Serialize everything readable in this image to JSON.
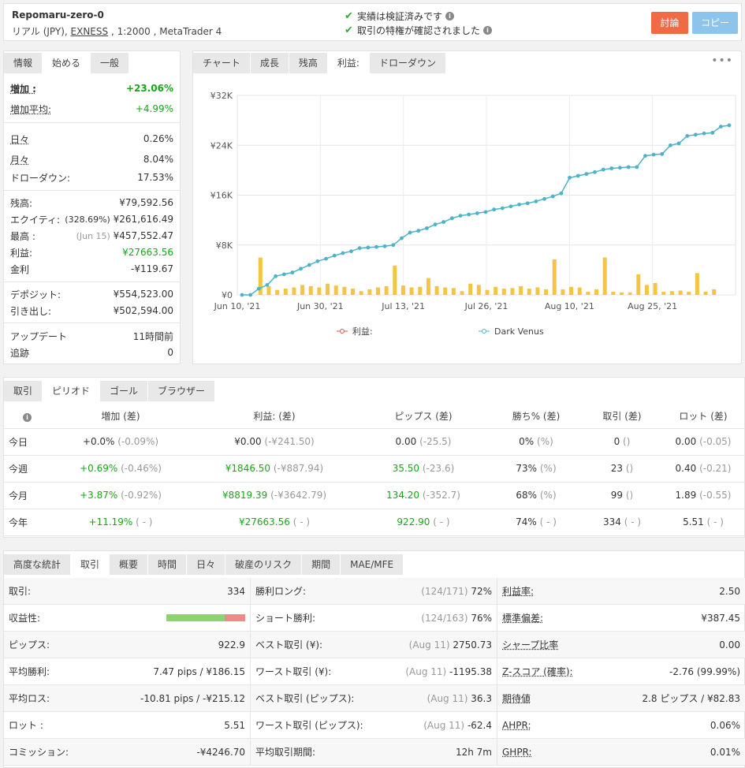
{
  "account": {
    "name": "Repomaru-zero-0",
    "info_prefix": "リアル (JPY), ",
    "broker": "EXNESS",
    "info_suffix": " , 1:2000 , MetaTrader 4",
    "verified_track": "実績は検証済みです",
    "verified_privileges": "取引の特権が確認されました",
    "discuss_label": "討論",
    "copy_label": "コピー"
  },
  "left_tabs": [
    "情報",
    "始める",
    "一般"
  ],
  "stats": {
    "gain": {
      "label": "増加 :",
      "value": "+23.06%"
    },
    "abs_gain": {
      "label": "増加平均:",
      "value": "+4.99%"
    },
    "daily": {
      "label": "日々",
      "value": "0.26%"
    },
    "monthly": {
      "label": "月々",
      "value": "8.04%"
    },
    "drawdown": {
      "label": "ドローダウン:",
      "value": "17.53%"
    },
    "balance": {
      "label": "残高:",
      "value": "¥79,592.56"
    },
    "equity": {
      "label": "エクイティ:",
      "note": "(328.69%)",
      "value": "¥261,616.49"
    },
    "highest": {
      "label": "最高 :",
      "note": "(Jun 15)",
      "value": "¥457,552.47"
    },
    "profit": {
      "label": "利益:",
      "value": "¥27663.56"
    },
    "interest": {
      "label": "金利",
      "value": "-¥119.67"
    },
    "deposits": {
      "label": "デポジット:",
      "value": "¥554,523.00"
    },
    "withdrawals": {
      "label": "引き出し:",
      "value": "¥502,594.00"
    },
    "updated": {
      "label": "アップデート",
      "value": "11時間前"
    },
    "tracking": {
      "label": "追跡",
      "value": "0"
    }
  },
  "chart_tabs": [
    "チャート",
    "成長",
    "残高",
    "利益:",
    "ドローダウン"
  ],
  "chart_more_icon": "more-dots-icon",
  "chart_data": {
    "type": "line",
    "y_ticks": [
      "¥0",
      "¥8K",
      "¥16K",
      "¥24K",
      "¥32K"
    ],
    "ylim": [
      0,
      32000
    ],
    "x_ticks": [
      "Jun 10, '21",
      "Jun 30, '21",
      "Jul 13, '21",
      "Jul 26, '21",
      "Aug 10, '21",
      "Aug 25, '21"
    ],
    "grid": true,
    "legend_position": "bottom",
    "series": [
      {
        "name": "利益:",
        "color": "#f4c542",
        "type": "bar",
        "values": [
          0,
          0,
          6000,
          1400,
          800,
          1000,
          1200,
          1600,
          1400,
          1200,
          1800,
          1500,
          1300,
          1000,
          600,
          900,
          1200,
          1400,
          4700,
          1500,
          1200,
          1300,
          2700,
          1400,
          1200,
          1100,
          600,
          1800,
          1600,
          800,
          1300,
          1000,
          1100,
          1400,
          1000,
          1200,
          900,
          5700,
          900,
          1300,
          1200,
          500,
          900,
          6000,
          500,
          400,
          400,
          3300,
          1600,
          1900,
          500,
          600,
          700,
          500,
          3500,
          500,
          900
        ]
      },
      {
        "name": "Dark Venus",
        "color": "#4cb3c8",
        "type": "line",
        "values": [
          0,
          0,
          1000,
          1600,
          3000,
          3300,
          3600,
          4200,
          4800,
          5400,
          5800,
          6300,
          6700,
          7000,
          7500,
          7600,
          7700,
          7800,
          8000,
          9100,
          10000,
          10300,
          10700,
          11300,
          11700,
          12300,
          12700,
          12900,
          13100,
          13300,
          13700,
          13900,
          14200,
          14500,
          14700,
          15000,
          15400,
          15800,
          16300,
          18800,
          19100,
          19400,
          19700,
          20100,
          20300,
          20400,
          20500,
          20500,
          22300,
          22500,
          22600,
          24000,
          24300,
          25500,
          25700,
          25900,
          26000,
          27000,
          27200
        ]
      }
    ]
  },
  "period": {
    "tabs": [
      "取引",
      "ピリオド",
      "ゴール",
      "ブラウザー"
    ],
    "headers": [
      "増加 (差)",
      "利益: (差)",
      "ピップス (差)",
      "勝ち% (差)",
      "取引 (差)",
      "ロット (差)"
    ],
    "rows": [
      {
        "name": "今日",
        "gain": "+0.0%",
        "gain_d": "(-0.09%)",
        "profit": "¥0.00",
        "profit_d": "(-¥241.50)",
        "pips": "0.00",
        "pips_d": "(-25.5)",
        "win": "0%",
        "win_d": "(%)",
        "trades": "0",
        "trades_d": "()",
        "lots": "0.00",
        "lots_d": "(-0.05)",
        "green": false
      },
      {
        "name": "今週",
        "gain": "+0.69%",
        "gain_d": "(-0.46%)",
        "profit": "¥1846.50",
        "profit_d": "(-¥887.94)",
        "pips": "35.50",
        "pips_d": "(-23.6)",
        "win": "73%",
        "win_d": "(%)",
        "trades": "23",
        "trades_d": "()",
        "lots": "0.40",
        "lots_d": "(-0.21)",
        "green": true
      },
      {
        "name": "今月",
        "gain": "+3.87%",
        "gain_d": "(-0.92%)",
        "profit": "¥8819.39",
        "profit_d": "(-¥3642.79)",
        "pips": "134.20",
        "pips_d": "(-352.7)",
        "win": "68%",
        "win_d": "(%)",
        "trades": "99",
        "trades_d": "()",
        "lots": "1.89",
        "lots_d": "(-0.55)",
        "green": true
      },
      {
        "name": "今年",
        "gain": "+11.19%",
        "gain_d": "( - )",
        "profit": "¥27663.56",
        "profit_d": "( - )",
        "pips": "922.90",
        "pips_d": "( - )",
        "win": "74%",
        "win_d": "( - )",
        "trades": "334",
        "trades_d": "( - )",
        "lots": "5.51",
        "lots_d": "( - )",
        "green": true
      }
    ]
  },
  "advanced": {
    "tabs": [
      "高度な統計",
      "取引",
      "概要",
      "時間",
      "日々",
      "破産のリスク",
      "期間",
      "MAE/MFE"
    ],
    "col1": [
      {
        "label": "取引:",
        "value": "334"
      },
      {
        "label": "収益性:",
        "value": ""
      },
      {
        "label": "ピップス:",
        "value": "922.9"
      },
      {
        "label": "平均勝利:",
        "value": "7.47 pips / ¥186.15"
      },
      {
        "label": "平均ロス:",
        "value": "-10.81 pips / -¥215.12"
      },
      {
        "label": "ロット :",
        "value": "5.51"
      },
      {
        "label": "コミッション:",
        "value": "-¥4246.70"
      }
    ],
    "profitability": {
      "win_fraction": 0.74
    },
    "col2": [
      {
        "label": "勝利ロング:",
        "note": "(124/171)",
        "value": "72%"
      },
      {
        "label": "ショート勝利:",
        "note": "(124/163)",
        "value": "76%"
      },
      {
        "label": "ベスト取引 (¥):",
        "note": "(Aug 11)",
        "value": "2750.73"
      },
      {
        "label": "ワースト取引 (¥):",
        "note": "(Aug 11)",
        "value": "-1195.38"
      },
      {
        "label": "ベスト取引 (ピップス):",
        "note": "(Aug 11)",
        "value": "36.3"
      },
      {
        "label": "ワースト取引 (ピップス):",
        "note": "(Aug 11)",
        "value": "-62.4"
      },
      {
        "label": "平均取引期間:",
        "note": "",
        "value": "12h 7m"
      }
    ],
    "col3": [
      {
        "label": "利益率:",
        "value": "2.50"
      },
      {
        "label": "標準偏差:",
        "value": "¥387.45"
      },
      {
        "label": "シャープ比率",
        "value": "0.00"
      },
      {
        "label": "Z-スコア (確率):",
        "value": "-2.76 (99.99%)"
      },
      {
        "label": "期待値",
        "value": "2.8 ピップス / ¥82.83"
      },
      {
        "label": "AHPR:",
        "value": "0.06%"
      },
      {
        "label": "GHPR:",
        "value": "0.01%"
      }
    ]
  }
}
